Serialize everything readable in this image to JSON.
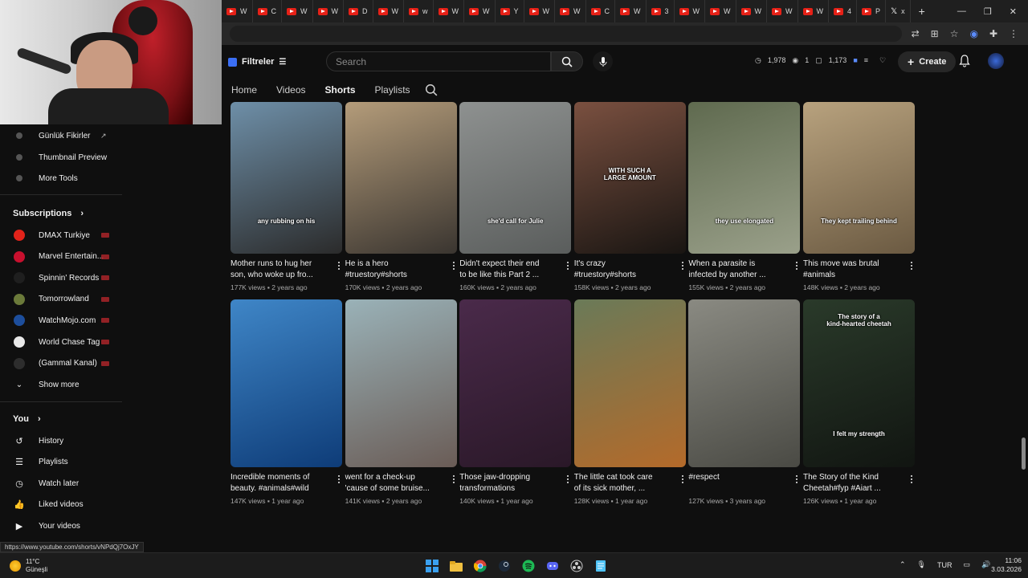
{
  "browser": {
    "tabs": [
      {
        "label": "W",
        "icon": "youtube-icon"
      },
      {
        "label": "C",
        "icon": "youtube-icon"
      },
      {
        "label": "W",
        "icon": "youtube-icon"
      },
      {
        "label": "W",
        "icon": "youtube-icon"
      },
      {
        "label": "D",
        "icon": "youtube-icon"
      },
      {
        "label": "W",
        "icon": "youtube-icon"
      },
      {
        "label": "w",
        "icon": "youtube-icon"
      },
      {
        "label": "W",
        "icon": "youtube-icon"
      },
      {
        "label": "W",
        "icon": "youtube-icon"
      },
      {
        "label": "Y",
        "icon": "youtube-icon"
      },
      {
        "label": "W",
        "icon": "youtube-icon"
      },
      {
        "label": "W",
        "icon": "youtube-icon"
      },
      {
        "label": "C",
        "icon": "youtube-icon"
      },
      {
        "label": "W",
        "icon": "youtube-icon"
      },
      {
        "label": "3",
        "icon": "youtube-icon"
      },
      {
        "label": "W",
        "icon": "youtube-icon"
      },
      {
        "label": "W",
        "icon": "youtube-icon"
      },
      {
        "label": "W",
        "icon": "youtube-icon"
      },
      {
        "label": "W",
        "icon": "youtube-icon"
      },
      {
        "label": "W",
        "icon": "youtube-icon"
      },
      {
        "label": "4",
        "icon": "youtube-icon"
      },
      {
        "label": "P",
        "icon": "youtube-icon"
      },
      {
        "label": "x",
        "icon": "x-icon"
      }
    ],
    "new_tab": "+",
    "status_url": "https://www.youtube.com/shorts/vNPdQj7OxJY"
  },
  "header": {
    "filter_label": "Filtreler",
    "search_placeholder": "Search",
    "stats": [
      "1,978",
      "1",
      "1,173"
    ],
    "create_label": "Create"
  },
  "channel_tabs": [
    {
      "label": "Home",
      "active": false
    },
    {
      "label": "Videos",
      "active": false
    },
    {
      "label": "Shorts",
      "active": true
    },
    {
      "label": "Playlists",
      "active": false
    }
  ],
  "sidebar": {
    "tools": [
      {
        "label": "Günlük Fikirler",
        "external": true
      },
      {
        "label": "Thumbnail Preview"
      },
      {
        "label": "More Tools"
      }
    ],
    "subscriptions_title": "Subscriptions",
    "subscriptions": [
      {
        "label": "DMAX Turkiye",
        "color": "#e2231a"
      },
      {
        "label": "Marvel Entertain...",
        "color": "#c8102e"
      },
      {
        "label": "Spinnin' Records",
        "color": "#1f1f1f"
      },
      {
        "label": "Tomorrowland",
        "color": "#6b7a3a"
      },
      {
        "label": "WatchMojo.com",
        "color": "#1d4e9c"
      },
      {
        "label": "World Chase Tag",
        "color": "#e8e8e8"
      },
      {
        "label": "(Gammal Kanal)",
        "color": "#2d2d2d"
      }
    ],
    "show_more": "Show more",
    "you_title": "You",
    "you_items": [
      {
        "label": "History",
        "icon": "history-icon"
      },
      {
        "label": "Playlists",
        "icon": "playlists-icon"
      },
      {
        "label": "Watch later",
        "icon": "watch-later-icon"
      },
      {
        "label": "Liked videos",
        "icon": "liked-icon"
      },
      {
        "label": "Your videos",
        "icon": "your-videos-icon"
      }
    ]
  },
  "shorts": [
    {
      "title1": "Mother runs to hug her",
      "title2": "son, who woke up fro...",
      "views": "177K views",
      "age": "2 years ago",
      "caption": "any rubbing on his",
      "caption2": "",
      "colors": [
        "#6e8fa8",
        "#2b2b2b"
      ]
    },
    {
      "title1": "He is a hero",
      "title2": "#truestory#shorts",
      "views": "170K views",
      "age": "2 years ago",
      "caption": "",
      "caption2": "",
      "colors": [
        "#b49c7a",
        "#3a3530"
      ]
    },
    {
      "title1": "Didn't expect their end",
      "title2": "to be like this  Part 2 ...",
      "views": "160K views",
      "age": "2 years ago",
      "caption": "she'd call for Julie",
      "caption2": "",
      "colors": [
        "#8e9190",
        "#5a5d5c"
      ]
    },
    {
      "title1": "It's crazy",
      "title2": "#truestory#shorts",
      "views": "158K views",
      "age": "2 years ago",
      "caption": "WITH SUCH A",
      "caption2": "LARGE AMOUNT",
      "colors": [
        "#7a5040",
        "#191512"
      ]
    },
    {
      "title1": "When a parasite is",
      "title2": "infected by another ...",
      "views": "155K views",
      "age": "2 years ago",
      "caption": "they use elongated",
      "caption2": "",
      "colors": [
        "#5f6a4f",
        "#9aa08a"
      ]
    },
    {
      "title1": "This move was brutal",
      "title2": "#animals",
      "views": "148K views",
      "age": "2 years ago",
      "caption": "They kept trailing behind",
      "caption2": "",
      "colors": [
        "#b8a27e",
        "#6b5a42"
      ]
    },
    {
      "title1": "Incredible moments of",
      "title2": "beauty. #animals#wild",
      "views": "147K views",
      "age": "1 year ago",
      "caption": "",
      "caption2": "",
      "colors": [
        "#3f86c7",
        "#0e3c78"
      ]
    },
    {
      "title1": "went for a check-up",
      "title2": "'cause of some bruise...",
      "views": "141K views",
      "age": "2 years ago",
      "caption": "",
      "caption2": "",
      "colors": [
        "#9ab2b8",
        "#6a5c56"
      ]
    },
    {
      "title1": "Those jaw-dropping",
      "title2": "transformations",
      "views": "140K views",
      "age": "1 year ago",
      "caption": "",
      "caption2": "",
      "colors": [
        "#4a2a4a",
        "#2a1828"
      ]
    },
    {
      "title1": "The little cat took care",
      "title2": "of its sick mother, ...",
      "views": "128K views",
      "age": "1 year ago",
      "caption": "",
      "caption2": "",
      "colors": [
        "#6a7a58",
        "#b46a2a"
      ]
    },
    {
      "title1": "#respect",
      "title2": "",
      "views": "127K views",
      "age": "3 years ago",
      "caption": "",
      "caption2": "",
      "colors": [
        "#8a8a82",
        "#4a4a44"
      ]
    },
    {
      "title1": "The Story of the Kind",
      "title2": "Cheetah#fyp #Aiart ...",
      "views": "126K views",
      "age": "1 year ago",
      "caption": "The story of a",
      "caption2": "kind-hearted cheetah",
      "bottom_caption": "I felt my strength",
      "colors": [
        "#2a3a2a",
        "#111511"
      ]
    }
  ],
  "taskbar": {
    "temp": "11°C",
    "weather": "Güneşli",
    "lang": "TUR",
    "time": "11:06",
    "date": "3.03.2026"
  }
}
